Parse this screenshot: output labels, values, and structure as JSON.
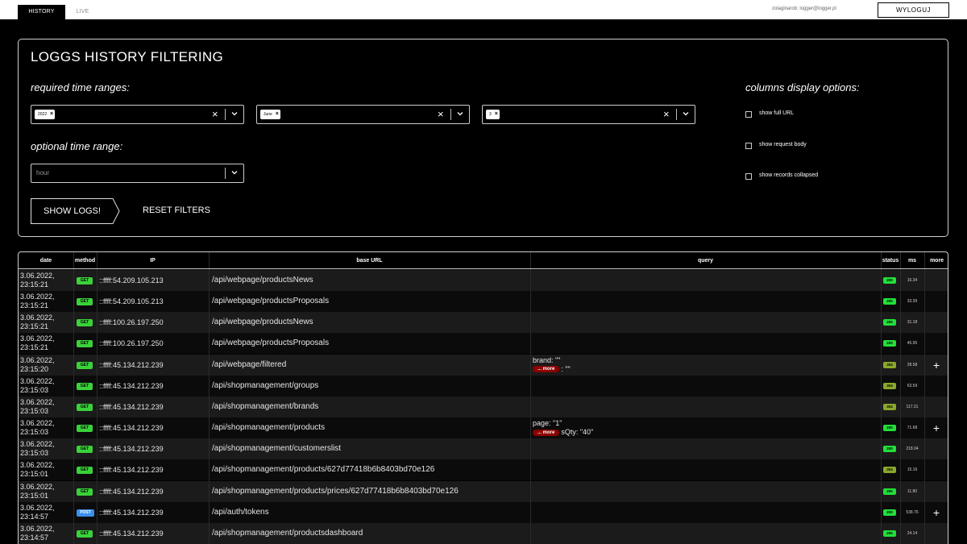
{
  "nav": {
    "tabs": [
      {
        "label": "HISTORY"
      },
      {
        "label": "LIVE"
      }
    ],
    "user_email": "zolaginarob: logger@logger.pl",
    "logout_label": "WYLOGUJ"
  },
  "filters": {
    "title": "LOGGS HISTORY FILTERING",
    "required_label": "required time ranges:",
    "optional_label": "optional time range:",
    "columns_label": "columns display options:",
    "year_chip": "2022",
    "month_chip": "June",
    "day_chip": "3",
    "hour_placeholder": "hour",
    "options": {
      "full_url": "show full URL",
      "request_body": "show request body",
      "records_collapsed": "show records collapsed"
    },
    "show_logs_label": "SHOW LOGS!",
    "reset_label": "RESET FILTERS"
  },
  "colors": {
    "get": "#3ad13a",
    "post": "#3a8fe8",
    "status_200": "#22e03a",
    "status_304": "#8aa82c",
    "more_pill": "#8b0000"
  },
  "table": {
    "headers": {
      "date": "date",
      "method": "method",
      "ip": "IP",
      "base_url": "base URL",
      "query": "query",
      "status": "status",
      "ms": "ms",
      "more": "more"
    },
    "rows": [
      {
        "date1": "3.06.2022,",
        "date2": "23:15:21",
        "method": "GET",
        "ip": "::ffff:54.209.105.213",
        "url": "/api/webpage/productsNews",
        "q1": "",
        "q2": "",
        "status": "200",
        "ms": "16.34",
        "more": ""
      },
      {
        "date1": "3.06.2022,",
        "date2": "23:15:21",
        "method": "GET",
        "ip": "::ffff:54.209.105.213",
        "url": "/api/webpage/productsProposals",
        "q1": "",
        "q2": "",
        "status": "200",
        "ms": "33.39",
        "more": ""
      },
      {
        "date1": "3.06.2022,",
        "date2": "23:15:21",
        "method": "GET",
        "ip": "::ffff:100.26.197.250",
        "url": "/api/webpage/productsNews",
        "q1": "",
        "q2": "",
        "status": "200",
        "ms": "31.18",
        "more": ""
      },
      {
        "date1": "3.06.2022,",
        "date2": "23:15:21",
        "method": "GET",
        "ip": "::ffff:100.26.197.250",
        "url": "/api/webpage/productsProposals",
        "q1": "",
        "q2": "",
        "status": "200",
        "ms": "45.95",
        "more": ""
      },
      {
        "date1": "3.06.2022,",
        "date2": "23:15:20",
        "method": "GET",
        "ip": "::ffff:45.134.212.239",
        "url": "/api/webpage/filtered",
        "q1": "brand: \"\"",
        "q2": ": \"\"",
        "status": "304",
        "ms": "28.58",
        "more": "+"
      },
      {
        "date1": "3.06.2022,",
        "date2": "23:15:03",
        "method": "GET",
        "ip": "::ffff:45.134.212.239",
        "url": "/api/shopmanagement/groups",
        "q1": "",
        "q2": "",
        "status": "304",
        "ms": "63.59",
        "more": ""
      },
      {
        "date1": "3.06.2022,",
        "date2": "23:15:03",
        "method": "GET",
        "ip": "::ffff:45.134.212.239",
        "url": "/api/shopmanagement/brands",
        "q1": "",
        "q2": "",
        "status": "304",
        "ms": "117.31",
        "more": ""
      },
      {
        "date1": "3.06.2022,",
        "date2": "23:15:03",
        "method": "GET",
        "ip": "::ffff:45.134.212.239",
        "url": "/api/shopmanagement/products",
        "q1": "page: \"1\"",
        "q2": "sQty: \"40\"",
        "status": "200",
        "ms": "71.68",
        "more": "+"
      },
      {
        "date1": "3.06.2022,",
        "date2": "23:15:03",
        "method": "GET",
        "ip": "::ffff:45.134.212.239",
        "url": "/api/shopmanagement/customerslist",
        "q1": "",
        "q2": "",
        "status": "200",
        "ms": "218.04",
        "more": ""
      },
      {
        "date1": "3.06.2022,",
        "date2": "23:15:01",
        "method": "GET",
        "ip": "::ffff:45.134.212.239",
        "url": "/api/shopmanagement/products/627d77418b6b8403bd70e126",
        "q1": "",
        "q2": "",
        "status": "304",
        "ms": "15.16",
        "more": ""
      },
      {
        "date1": "3.06.2022,",
        "date2": "23:15:01",
        "method": "GET",
        "ip": "::ffff:45.134.212.239",
        "url": "/api/shopmanagement/products/prices/627d77418b6b8403bd70e126",
        "q1": "",
        "q2": "",
        "status": "200",
        "ms": "11.80",
        "more": ""
      },
      {
        "date1": "3.06.2022,",
        "date2": "23:14:57",
        "method": "POST",
        "ip": "::ffff:45.134.212.239",
        "url": "/api/auth/tokens",
        "q1": "",
        "q2": "",
        "status": "200",
        "ms": "538.76",
        "more": "+"
      },
      {
        "date1": "3.06.2022,",
        "date2": "23:14:57",
        "method": "GET",
        "ip": "::ffff:45.134.212.239",
        "url": "/api/shopmanagement/productsdashboard",
        "q1": "",
        "q2": "",
        "status": "200",
        "ms": "24.14",
        "more": ""
      }
    ],
    "more_pill_label": "... more"
  }
}
